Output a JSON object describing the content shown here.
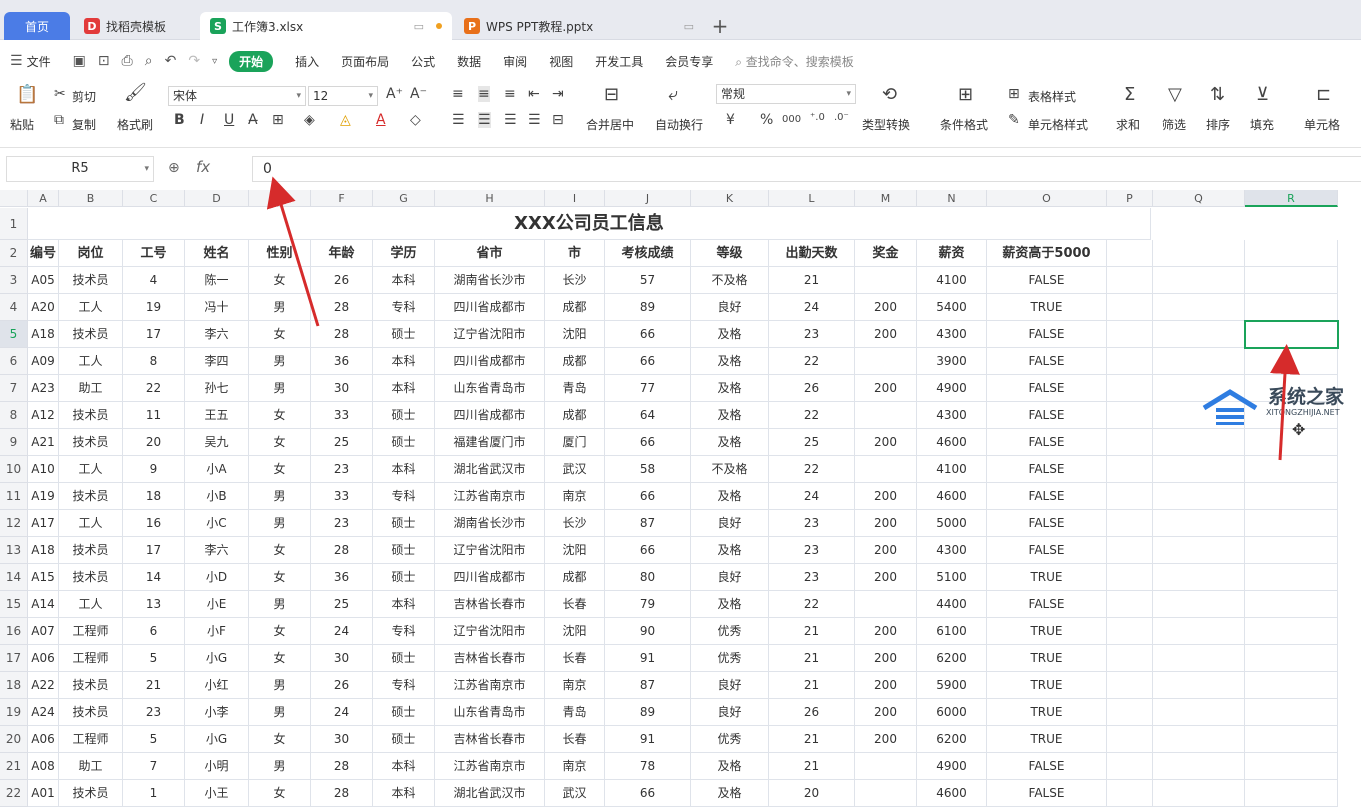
{
  "tabs": {
    "home": "首页",
    "t1": "找稻壳模板",
    "t2": "工作簿3.xlsx",
    "t3": "WPS PPT教程.pptx",
    "t1_badge": "D",
    "t2_badge": "S",
    "t3_badge": "P",
    "plus": "+"
  },
  "menu": {
    "file": "文件",
    "start": "开始",
    "items": [
      "插入",
      "页面布局",
      "公式",
      "数据",
      "审阅",
      "视图",
      "开发工具",
      "会员专享"
    ],
    "search": "查找命令、搜索模板"
  },
  "ribbon": {
    "paste": "粘贴",
    "cut": "剪切",
    "copy": "复制",
    "format_painter": "格式刷",
    "font": "宋体",
    "size": "12",
    "merge": "合并居中",
    "wrap": "自动换行",
    "numfmt": "常规",
    "convert": "类型转换",
    "cond": "条件格式",
    "table_style": "表格样式",
    "cell_style": "单元格样式",
    "sum": "求和",
    "filter": "筛选",
    "sort": "排序",
    "fill": "填充",
    "cell": "单元格",
    "bold": "B",
    "italic": "I",
    "underline": "U",
    "currency": "¥",
    "percent": "%",
    "thousands": "000"
  },
  "formula": {
    "cell": "R5",
    "fx": "fx",
    "value": "0"
  },
  "columns": [
    "A",
    "B",
    "C",
    "D",
    "E",
    "F",
    "G",
    "H",
    "I",
    "J",
    "K",
    "L",
    "M",
    "N",
    "O",
    "P",
    "Q",
    "R"
  ],
  "sheet_title": "XXX公司员工信息",
  "headers": [
    "编号",
    "岗位",
    "工号",
    "姓名",
    "性别",
    "年龄",
    "学历",
    "省市",
    "市",
    "考核成绩",
    "等级",
    "出勤天数",
    "奖金",
    "薪资",
    "薪资高于5000"
  ],
  "rows": [
    [
      "A05",
      "技术员",
      "4",
      "陈一",
      "女",
      "26",
      "本科",
      "湖南省长沙市",
      "长沙",
      "57",
      "不及格",
      "21",
      "",
      "4100",
      "FALSE"
    ],
    [
      "A20",
      "工人",
      "19",
      "冯十",
      "男",
      "28",
      "专科",
      "四川省成都市",
      "成都",
      "89",
      "良好",
      "24",
      "200",
      "5400",
      "TRUE"
    ],
    [
      "A18",
      "技术员",
      "17",
      "李六",
      "女",
      "28",
      "硕士",
      "辽宁省沈阳市",
      "沈阳",
      "66",
      "及格",
      "23",
      "200",
      "4300",
      "FALSE"
    ],
    [
      "A09",
      "工人",
      "8",
      "李四",
      "男",
      "36",
      "本科",
      "四川省成都市",
      "成都",
      "66",
      "及格",
      "22",
      "",
      "3900",
      "FALSE"
    ],
    [
      "A23",
      "助工",
      "22",
      "孙七",
      "男",
      "30",
      "本科",
      "山东省青岛市",
      "青岛",
      "77",
      "及格",
      "26",
      "200",
      "4900",
      "FALSE"
    ],
    [
      "A12",
      "技术员",
      "11",
      "王五",
      "女",
      "33",
      "硕士",
      "四川省成都市",
      "成都",
      "64",
      "及格",
      "22",
      "",
      "4300",
      "FALSE"
    ],
    [
      "A21",
      "技术员",
      "20",
      "吴九",
      "女",
      "25",
      "硕士",
      "福建省厦门市",
      "厦门",
      "66",
      "及格",
      "25",
      "200",
      "4600",
      "FALSE"
    ],
    [
      "A10",
      "工人",
      "9",
      "小A",
      "女",
      "23",
      "本科",
      "湖北省武汉市",
      "武汉",
      "58",
      "不及格",
      "22",
      "",
      "4100",
      "FALSE"
    ],
    [
      "A19",
      "技术员",
      "18",
      "小B",
      "男",
      "33",
      "专科",
      "江苏省南京市",
      "南京",
      "66",
      "及格",
      "24",
      "200",
      "4600",
      "FALSE"
    ],
    [
      "A17",
      "工人",
      "16",
      "小C",
      "男",
      "23",
      "硕士",
      "湖南省长沙市",
      "长沙",
      "87",
      "良好",
      "23",
      "200",
      "5000",
      "FALSE"
    ],
    [
      "A18",
      "技术员",
      "17",
      "李六",
      "女",
      "28",
      "硕士",
      "辽宁省沈阳市",
      "沈阳",
      "66",
      "及格",
      "23",
      "200",
      "4300",
      "FALSE"
    ],
    [
      "A15",
      "技术员",
      "14",
      "小D",
      "女",
      "36",
      "硕士",
      "四川省成都市",
      "成都",
      "80",
      "良好",
      "23",
      "200",
      "5100",
      "TRUE"
    ],
    [
      "A14",
      "工人",
      "13",
      "小E",
      "男",
      "25",
      "本科",
      "吉林省长春市",
      "长春",
      "79",
      "及格",
      "22",
      "",
      "4400",
      "FALSE"
    ],
    [
      "A07",
      "工程师",
      "6",
      "小F",
      "女",
      "24",
      "专科",
      "辽宁省沈阳市",
      "沈阳",
      "90",
      "优秀",
      "21",
      "200",
      "6100",
      "TRUE"
    ],
    [
      "A06",
      "工程师",
      "5",
      "小G",
      "女",
      "30",
      "硕士",
      "吉林省长春市",
      "长春",
      "91",
      "优秀",
      "21",
      "200",
      "6200",
      "TRUE"
    ],
    [
      "A22",
      "技术员",
      "21",
      "小红",
      "男",
      "26",
      "专科",
      "江苏省南京市",
      "南京",
      "87",
      "良好",
      "21",
      "200",
      "5900",
      "TRUE"
    ],
    [
      "A24",
      "技术员",
      "23",
      "小李",
      "男",
      "24",
      "硕士",
      "山东省青岛市",
      "青岛",
      "89",
      "良好",
      "26",
      "200",
      "6000",
      "TRUE"
    ],
    [
      "A06",
      "工程师",
      "5",
      "小G",
      "女",
      "30",
      "硕士",
      "吉林省长春市",
      "长春",
      "91",
      "优秀",
      "21",
      "200",
      "6200",
      "TRUE"
    ],
    [
      "A08",
      "助工",
      "7",
      "小明",
      "男",
      "28",
      "本科",
      "江苏省南京市",
      "南京",
      "78",
      "及格",
      "21",
      "",
      "4900",
      "FALSE"
    ],
    [
      "A01",
      "技术员",
      "1",
      "小王",
      "女",
      "28",
      "本科",
      "湖北省武汉市",
      "武汉",
      "66",
      "及格",
      "20",
      "",
      "4600",
      "FALSE"
    ]
  ],
  "watermark": {
    "name": "系统之家",
    "url": "XITONGZHIJIA.NET"
  },
  "colors": {
    "accent": "#1aa35a",
    "arrow": "#d62b2b",
    "home": "#4b7ce6"
  }
}
